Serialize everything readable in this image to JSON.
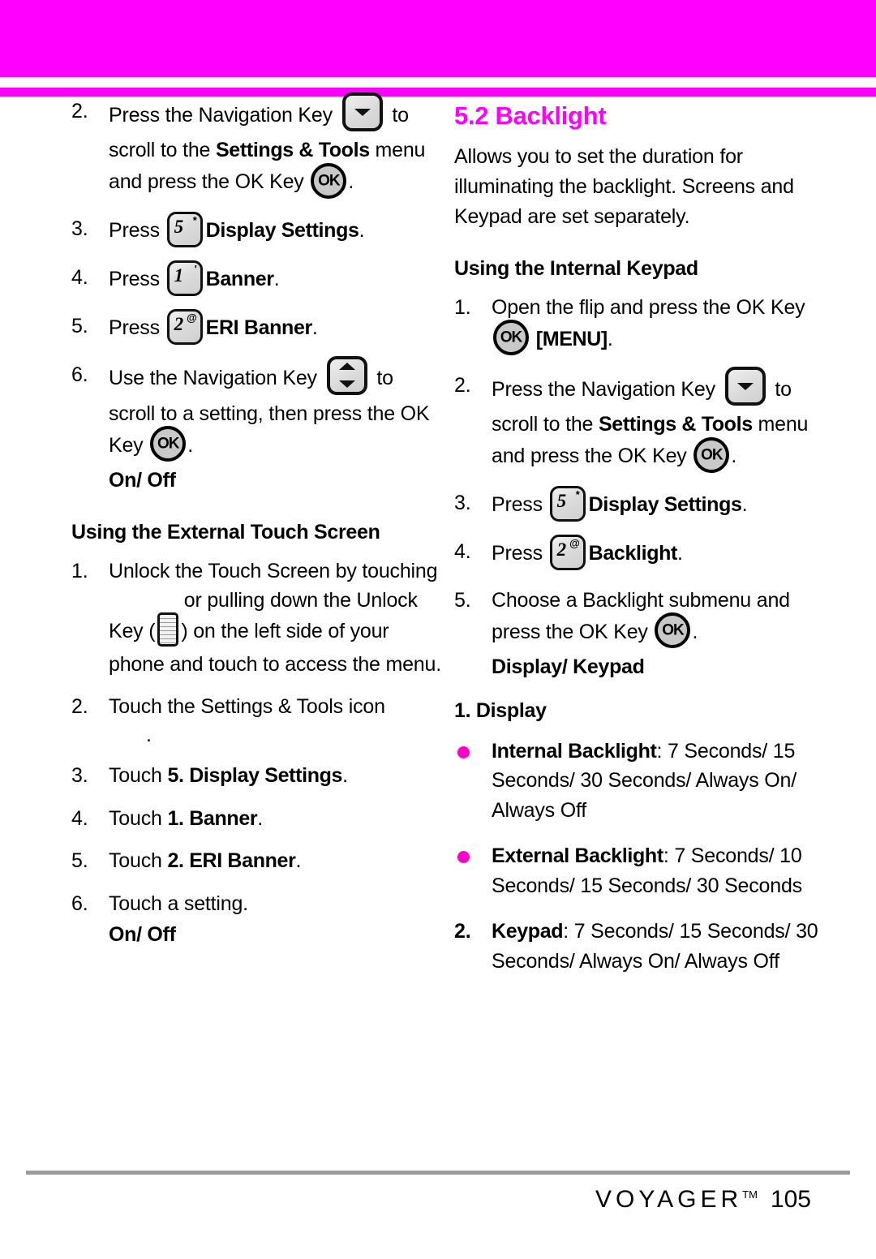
{
  "theme": {
    "accent": "#ff00ff",
    "bullet": "#ff00c8",
    "rule": "#9c9c9c",
    "text": "#000000"
  },
  "left_column": {
    "steps_internal": [
      {
        "num": "2.",
        "parts": [
          {
            "t": "text",
            "v": "Press the Navigation Key "
          },
          {
            "t": "icon",
            "v": "nav-key-down-icon"
          },
          {
            "t": "text",
            "v": " to scroll to the "
          },
          {
            "t": "bold",
            "v": "Settings & Tools"
          },
          {
            "t": "text",
            "v": " menu and press the OK Key "
          },
          {
            "t": "icon",
            "v": "ok-key-icon"
          },
          {
            "t": "text",
            "v": "."
          }
        ]
      },
      {
        "num": "3.",
        "parts": [
          {
            "t": "text",
            "v": "Press "
          },
          {
            "t": "key",
            "digit": "5",
            "sup": "*"
          },
          {
            "t": "bold",
            "v": "Display Settings"
          },
          {
            "t": "text",
            "v": "."
          }
        ]
      },
      {
        "num": "4.",
        "parts": [
          {
            "t": "text",
            "v": "Press "
          },
          {
            "t": "key",
            "digit": "1",
            "sup": "'"
          },
          {
            "t": "bold",
            "v": "Banner"
          },
          {
            "t": "text",
            "v": "."
          }
        ]
      },
      {
        "num": "5.",
        "parts": [
          {
            "t": "text",
            "v": "Press "
          },
          {
            "t": "key",
            "digit": "2",
            "sup": "@"
          },
          {
            "t": "bold",
            "v": "ERI Banner"
          },
          {
            "t": "text",
            "v": "."
          }
        ]
      },
      {
        "num": "6.",
        "parts": [
          {
            "t": "text",
            "v": "Use the Navigation Key "
          },
          {
            "t": "icon",
            "v": "nav-key-updown-icon"
          },
          {
            "t": "text",
            "v": " to scroll to a setting, then press the OK Key "
          },
          {
            "t": "icon",
            "v": "ok-key-icon"
          },
          {
            "t": "text",
            "v": "."
          }
        ],
        "note": "On/ Off"
      }
    ],
    "touch_heading": "Using the External Touch Screen",
    "steps_touch": [
      {
        "num": "1.",
        "parts": [
          {
            "t": "text",
            "v": "Unlock the Touch Screen by touching "
          },
          {
            "t": "gap",
            "v": "missing-figure"
          },
          {
            "t": "text",
            "v": " or pulling down the Unlock Key ("
          },
          {
            "t": "icon",
            "v": "unlock-key-icon"
          },
          {
            "t": "text",
            "v": ") on the left side of your phone and touch to access the menu."
          }
        ]
      },
      {
        "num": "2.",
        "parts": [
          {
            "t": "text",
            "v": "Touch the Settings & Tools icon"
          }
        ],
        "orphan": "."
      },
      {
        "num": "3.",
        "parts": [
          {
            "t": "text",
            "v": "Touch "
          },
          {
            "t": "bold",
            "v": "5. Display Settings"
          },
          {
            "t": "text",
            "v": "."
          }
        ]
      },
      {
        "num": "4.",
        "parts": [
          {
            "t": "text",
            "v": "Touch "
          },
          {
            "t": "bold",
            "v": "1. Banner"
          },
          {
            "t": "text",
            "v": "."
          }
        ]
      },
      {
        "num": "5.",
        "parts": [
          {
            "t": "text",
            "v": "Touch "
          },
          {
            "t": "bold",
            "v": "2. ERI Banner"
          },
          {
            "t": "text",
            "v": "."
          }
        ]
      },
      {
        "num": "6.",
        "parts": [
          {
            "t": "text",
            "v": "Touch a setting."
          }
        ],
        "note": "On/ Off"
      }
    ]
  },
  "right_column": {
    "section_title": "5.2 Backlight",
    "intro": "Allows you to set the duration for illuminating the backlight. Screens and Keypad are set separately.",
    "keypad_heading": "Using the Internal Keypad",
    "steps": [
      {
        "num": "1.",
        "parts": [
          {
            "t": "text",
            "v": "Open the flip and press the OK Key "
          },
          {
            "t": "icon",
            "v": "ok-key-icon"
          },
          {
            "t": "text",
            "v": " "
          },
          {
            "t": "bold",
            "v": "[MENU]"
          },
          {
            "t": "text",
            "v": "."
          }
        ]
      },
      {
        "num": "2.",
        "parts": [
          {
            "t": "text",
            "v": "Press the Navigation Key "
          },
          {
            "t": "icon",
            "v": "nav-key-down-icon"
          },
          {
            "t": "text",
            "v": " to scroll to the "
          },
          {
            "t": "bold",
            "v": "Settings & Tools"
          },
          {
            "t": "text",
            "v": " menu and press the OK Key "
          },
          {
            "t": "icon",
            "v": "ok-key-icon"
          },
          {
            "t": "text",
            "v": "."
          }
        ]
      },
      {
        "num": "3.",
        "parts": [
          {
            "t": "text",
            "v": "Press "
          },
          {
            "t": "key",
            "digit": "5",
            "sup": "*"
          },
          {
            "t": "bold",
            "v": "Display Settings"
          },
          {
            "t": "text",
            "v": "."
          }
        ]
      },
      {
        "num": "4.",
        "parts": [
          {
            "t": "text",
            "v": "Press "
          },
          {
            "t": "key",
            "digit": "2",
            "sup": "@"
          },
          {
            "t": "bold",
            "v": "Backlight"
          },
          {
            "t": "text",
            "v": "."
          }
        ]
      },
      {
        "num": "5.",
        "parts": [
          {
            "t": "text",
            "v": "Choose a Backlight submenu and press the OK Key "
          },
          {
            "t": "icon",
            "v": "ok-key-icon"
          },
          {
            "t": "text",
            "v": "."
          }
        ],
        "note": "Display/ Keypad"
      }
    ],
    "display_heading": "1. Display",
    "bullets": [
      {
        "label": "Internal Backlight",
        "values": ": 7 Seconds/ 15 Seconds/ 30 Seconds/ Always On/ Always Off"
      },
      {
        "label": "External Backlight",
        "values": ": 7 Seconds/ 10 Seconds/ 15 Seconds/ 30 Seconds"
      }
    ],
    "keypad_item": {
      "num": "2.",
      "label": "Keypad",
      "values": ": 7 Seconds/ 15 Seconds/ 30 Seconds/ Always On/ Always Off"
    }
  },
  "footer": {
    "brand": "VOYAGER",
    "tm": "TM",
    "page_number": "105"
  }
}
